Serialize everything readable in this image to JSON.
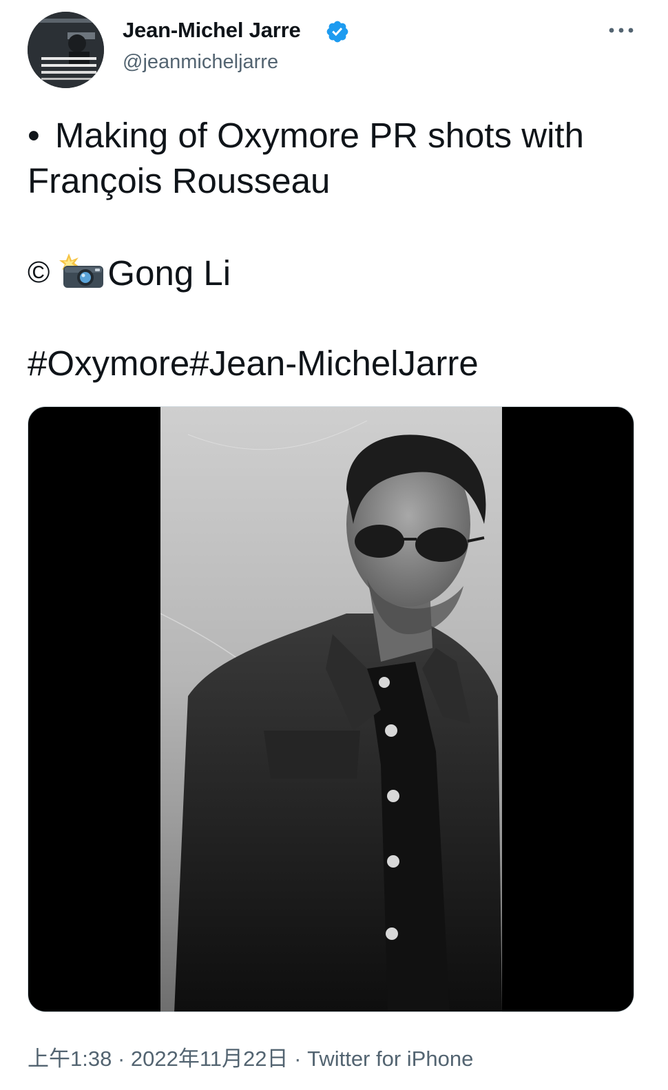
{
  "tweet": {
    "author": {
      "display_name": "Jean-Michel Jarre",
      "handle": "@jeanmicheljarre",
      "verified": true,
      "avatar_icon": "avatar-photo"
    },
    "text": {
      "line1_bullet": "•",
      "line1": "Making of Oxymore PR shots with",
      "line2": "François Rousseau",
      "line3_copyright": "©",
      "line3_emoji": "camera-flash-emoji",
      "line3": "Gong Li",
      "hashtags": [
        "#Oxymore",
        "#Jean-MichelJarre"
      ]
    },
    "media": {
      "type": "photo",
      "description_icon": "black-and-white-portrait"
    },
    "meta": {
      "time": "上午1:38",
      "separator": " · ",
      "date": "2022年11月22日",
      "source": "Twitter for iPhone"
    },
    "more_icon": "more-options-icon",
    "colors": {
      "text": "#0f1419",
      "secondary": "#536471",
      "verified": "#1d9bf0",
      "media_background": "#000000"
    }
  }
}
